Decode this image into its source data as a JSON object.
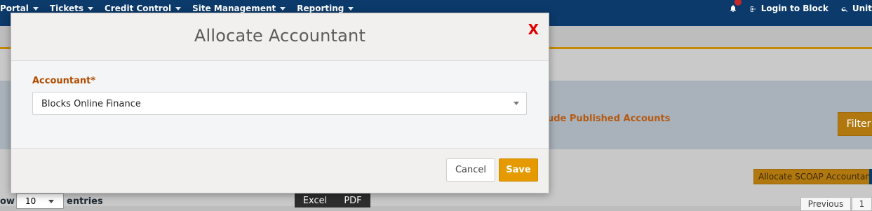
{
  "topbar": {
    "nav": [
      {
        "label": "Portal"
      },
      {
        "label": "Tickets"
      },
      {
        "label": "Credit Control"
      },
      {
        "label": "Site Management"
      },
      {
        "label": "Reporting"
      }
    ],
    "login_label": "Login to Block",
    "search_label": "Unit",
    "notification_icon": "bell-icon"
  },
  "background": {
    "published_accounts_label": "ude Published Accounts",
    "filter_label": "Filter",
    "scoap_label": "Allocate SCOAP Accountant",
    "show_label": "ow",
    "entries_value": "10",
    "entries_label": "entries",
    "excel_label": "Excel",
    "pdf_label": "PDF",
    "previous_label": "Previous",
    "page_1_label": "1"
  },
  "modal": {
    "title": "Allocate Accountant",
    "close_label": "X",
    "accountant_label": "Accountant*",
    "accountant_value": "Blocks Online Finance",
    "cancel_label": "Cancel",
    "save_label": "Save"
  },
  "colors": {
    "topbar": "#0b3a6b",
    "accent": "#e49a00",
    "label": "#b24b00",
    "close": "#e30000"
  }
}
